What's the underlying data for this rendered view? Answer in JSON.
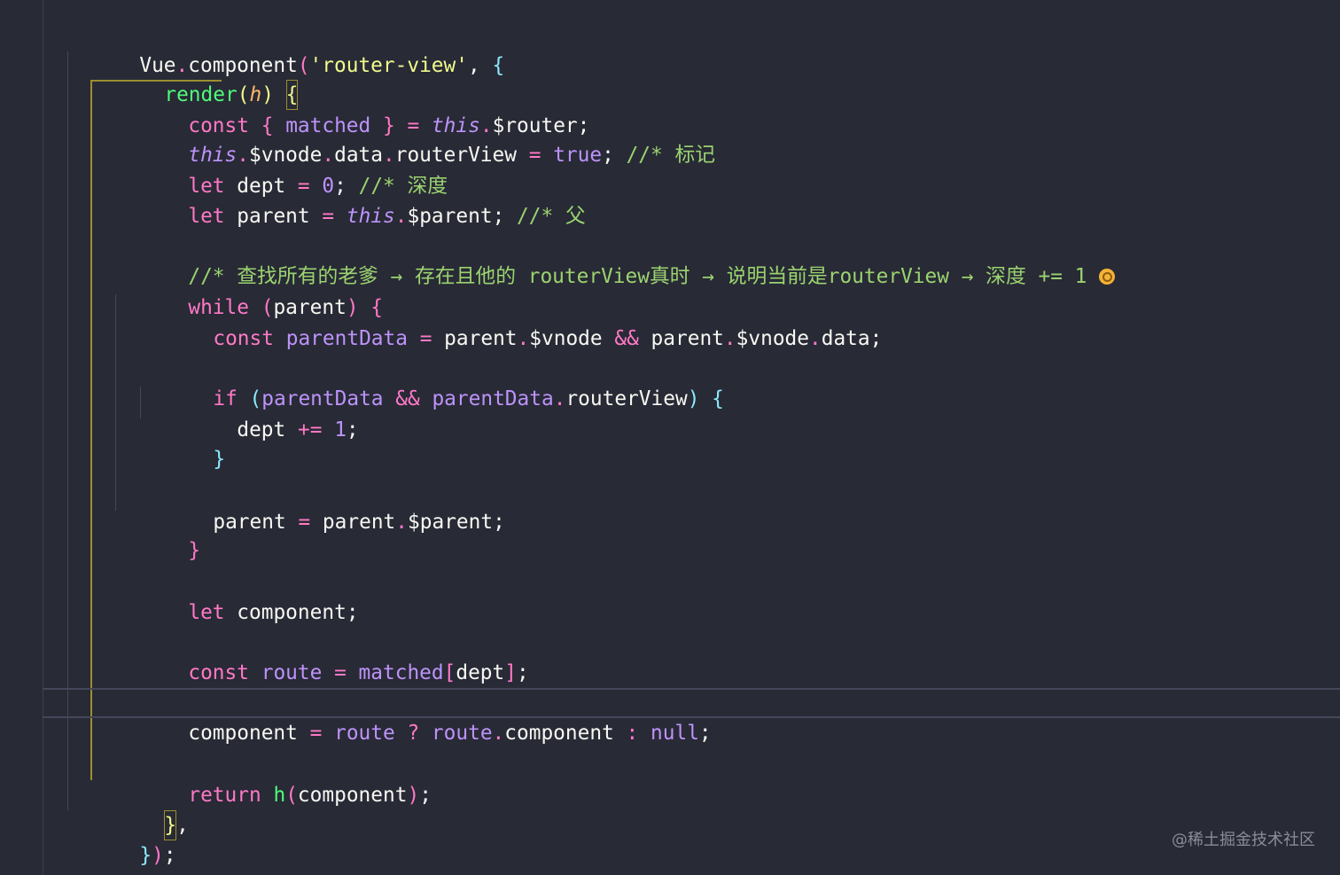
{
  "editor": {
    "theme": "dark",
    "background": "#282a36",
    "lines": [
      {
        "id": "l1",
        "text": "Vue.component('router-view', {"
      },
      {
        "id": "l2",
        "text": "render(h) {"
      },
      {
        "id": "l3",
        "text": "const { matched } = this.$router;"
      },
      {
        "id": "l4",
        "text": "this.$vnode.data.routerView = true; //* 标记"
      },
      {
        "id": "l5",
        "text": "let dept = 0; //* 深度"
      },
      {
        "id": "l6",
        "text": "let parent = this.$parent; //* 父"
      },
      {
        "id": "l7",
        "text": "//* 查找所有的老爹 → 存在且他的 routerView真时 → 说明当前是routerView → 深度 += 1"
      },
      {
        "id": "l8",
        "text": "while (parent) {"
      },
      {
        "id": "l9",
        "text": "const parentData = parent.$vnode && parent.$vnode.data;"
      },
      {
        "id": "l10",
        "text": "if (parentData && parentData.routerView) {"
      },
      {
        "id": "l11",
        "text": "dept += 1;"
      },
      {
        "id": "l12",
        "text": "}"
      },
      {
        "id": "l13",
        "text": "parent = parent.$parent;"
      },
      {
        "id": "l14",
        "text": "}"
      },
      {
        "id": "l15",
        "text": "let component;"
      },
      {
        "id": "l16",
        "text": "const route = matched[dept];"
      },
      {
        "id": "l17",
        "text": "component = route ? route.component : null;"
      },
      {
        "id": "l18",
        "text": "return h(component);"
      },
      {
        "id": "l19",
        "text": "},"
      },
      {
        "id": "l20",
        "text": "});"
      }
    ],
    "tokens": {
      "vue": "Vue",
      "dot": ".",
      "component_method": "component",
      "lparen": "(",
      "rparen": ")",
      "router_view_str": "'router-view'",
      "comma": ",",
      "lbrace": "{",
      "rbrace": "}",
      "render": "render",
      "h": "h",
      "const": "const",
      "let": "let",
      "while": "while",
      "if": "if",
      "return": "return",
      "matched": "matched",
      "eq": "=",
      "plus_eq": "+=",
      "this": "this",
      "router": "$router",
      "semi": ";",
      "vnode": "$vnode",
      "data": "data",
      "routerView": "routerView",
      "true": "true",
      "comment_mark": "//* 标记",
      "dept": "dept",
      "zero": "0",
      "comment_depth": "//* 深度",
      "parent": "parent",
      "dparent": "$parent",
      "comment_parent": "//* 父",
      "comment_long": "//* 查找所有的老爹 → 存在且他的 routerView真时 → 说明当前是routerView → 深度 += 1",
      "parentData": "parentData",
      "and": "&&",
      "one": "1",
      "component_var": "component",
      "route": "route",
      "lbracket": "[",
      "rbracket": "]",
      "question": "?",
      "colon": ":",
      "null": "null"
    },
    "emoji_icon": "ok-hand-icon"
  },
  "watermark": "@稀土掘金技术社区"
}
